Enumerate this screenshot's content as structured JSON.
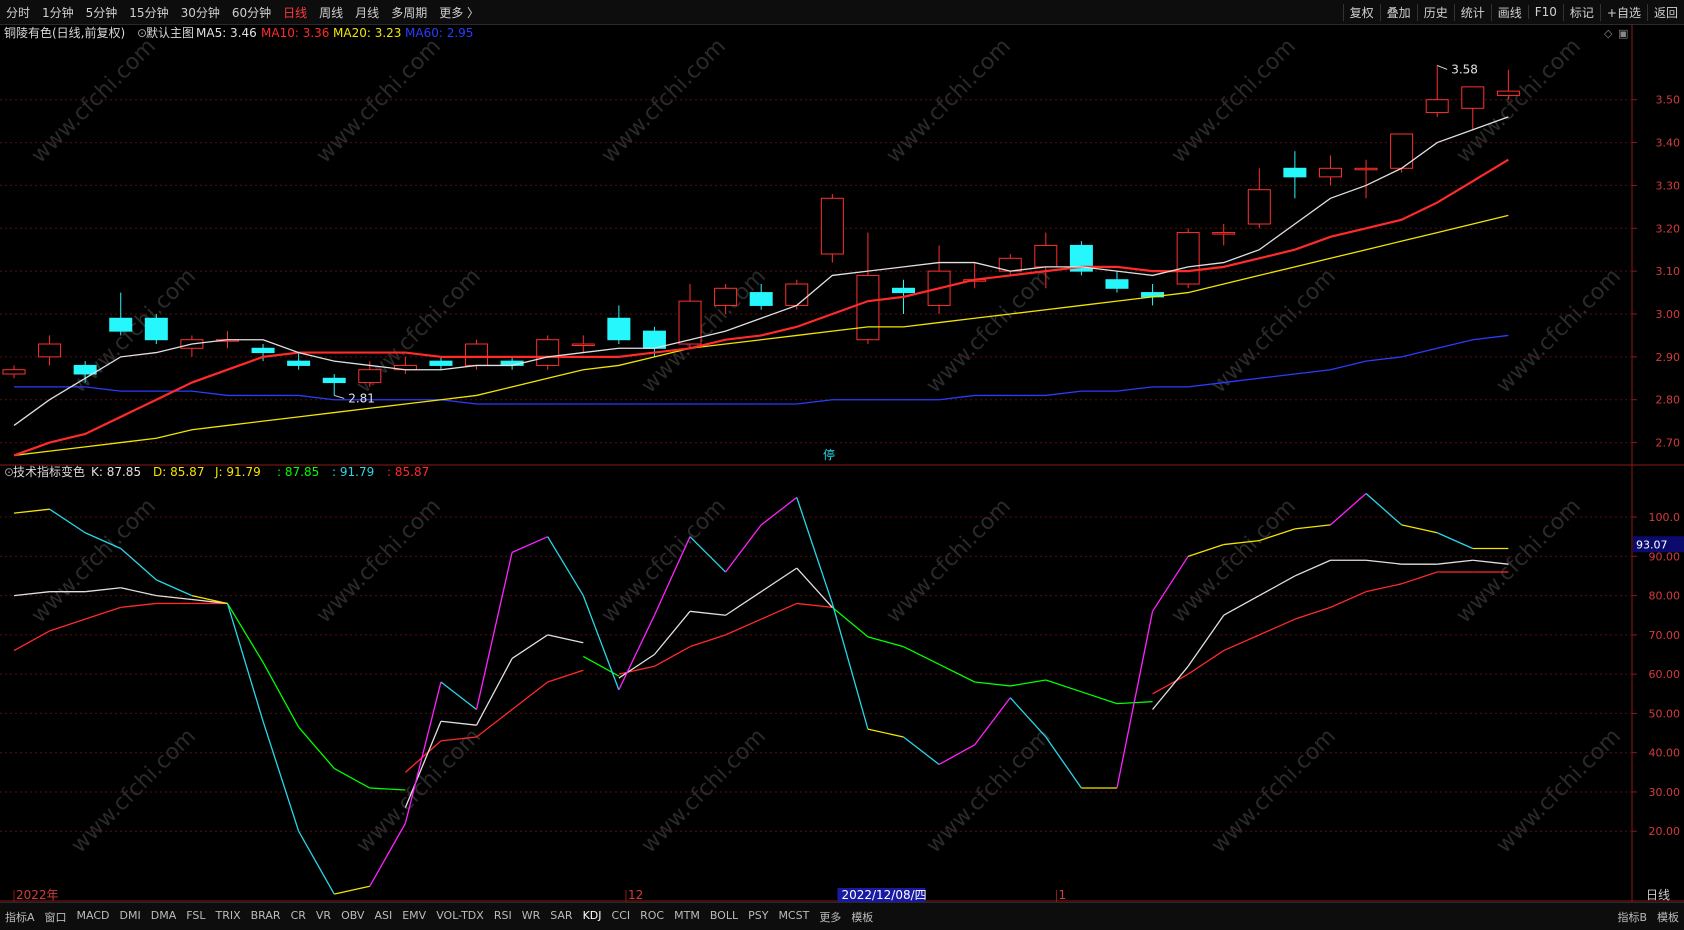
{
  "toolbar": {
    "periods": [
      "分时",
      "1分钟",
      "5分钟",
      "15分钟",
      "30分钟",
      "60分钟",
      "日线",
      "周线",
      "月线",
      "多周期",
      "更多 〉"
    ],
    "active_period": "日线",
    "actions": [
      "复权",
      "叠加",
      "历史",
      "统计",
      "画线",
      "F10",
      "标记",
      "+自选",
      "返回"
    ]
  },
  "main_panel": {
    "title": "铜陵有色(日线,前复权)",
    "indicator_name": "默认主图",
    "ma_labels": [
      {
        "text": "MA5: 3.46",
        "color": "#e0e0e0"
      },
      {
        "text": "MA10: 3.36",
        "color": "#ff2a2a"
      },
      {
        "text": "MA20: 3.23",
        "color": "#f2e400"
      },
      {
        "text": "MA60: 2.95",
        "color": "#2a3cff"
      }
    ],
    "high_label": "3.58",
    "low_label": "2.81",
    "marker_char": "停"
  },
  "sub_panel": {
    "indicator_name": "技术指标变色",
    "labels": [
      {
        "text": "K: 87.85",
        "color": "#e0e0e0"
      },
      {
        "text": "D: 85.87",
        "color": "#f2e400"
      },
      {
        "text": "J: 91.79",
        "color": "#f2e400"
      },
      {
        "text": ": 87.85",
        "color": "#00ff00"
      },
      {
        "text": ": 91.79",
        "color": "#27d8e8"
      },
      {
        "text": ": 85.87",
        "color": "#ff2a2a"
      }
    ],
    "current_value": "93.07"
  },
  "date_axis": {
    "labels": [
      {
        "text": "2022年",
        "index": 0
      },
      {
        "text": "12",
        "index": 17.2
      },
      {
        "text": "2022/12/08/四",
        "index": 23.2
      },
      {
        "text": "1",
        "index": 29.3
      }
    ],
    "right_label": "日线"
  },
  "bottom_tabs": [
    "指标A",
    "窗口",
    "MACD",
    "DMI",
    "DMA",
    "FSL",
    "TRIX",
    "BRAR",
    "CR",
    "VR",
    "OBV",
    "ASI",
    "EMV",
    "VOL-TDX",
    "RSI",
    "WR",
    "SAR",
    "KDJ",
    "CCI",
    "ROC",
    "MTM",
    "BOLL",
    "PSY",
    "MCST",
    "更多",
    "模板"
  ],
  "bottom_right": [
    "指标B",
    "模板"
  ],
  "watermark": "www.cfchi.com",
  "chart_data": {
    "type": "candlestick",
    "price_axis": {
      "ticks": [
        "2.70",
        "2.80",
        "2.90",
        "3.00",
        "3.10",
        "3.20",
        "3.30",
        "3.40",
        "3.50"
      ],
      "range": [
        2.65,
        3.63
      ]
    },
    "candles": [
      {
        "o": 2.86,
        "c": 2.87,
        "h": 2.88,
        "l": 2.85
      },
      {
        "o": 2.9,
        "c": 2.93,
        "h": 2.95,
        "l": 2.88
      },
      {
        "o": 2.88,
        "c": 2.86,
        "h": 2.89,
        "l": 2.84
      },
      {
        "o": 2.99,
        "c": 2.96,
        "h": 3.05,
        "l": 2.95
      },
      {
        "o": 2.99,
        "c": 2.94,
        "h": 3.0,
        "l": 2.93
      },
      {
        "o": 2.92,
        "c": 2.94,
        "h": 2.95,
        "l": 2.9
      },
      {
        "o": 2.94,
        "c": 2.94,
        "h": 2.96,
        "l": 2.92
      },
      {
        "o": 2.92,
        "c": 2.91,
        "h": 2.93,
        "l": 2.89
      },
      {
        "o": 2.89,
        "c": 2.88,
        "h": 2.91,
        "l": 2.87
      },
      {
        "o": 2.85,
        "c": 2.84,
        "h": 2.86,
        "l": 2.81
      },
      {
        "o": 2.84,
        "c": 2.87,
        "h": 2.89,
        "l": 2.83
      },
      {
        "o": 2.87,
        "c": 2.88,
        "h": 2.9,
        "l": 2.86
      },
      {
        "o": 2.89,
        "c": 2.88,
        "h": 2.9,
        "l": 2.87
      },
      {
        "o": 2.88,
        "c": 2.93,
        "h": 2.94,
        "l": 2.87
      },
      {
        "o": 2.89,
        "c": 2.88,
        "h": 2.9,
        "l": 2.87
      },
      {
        "o": 2.88,
        "c": 2.94,
        "h": 2.95,
        "l": 2.87
      },
      {
        "o": 2.93,
        "c": 2.93,
        "h": 2.95,
        "l": 2.91
      },
      {
        "o": 2.99,
        "c": 2.94,
        "h": 3.02,
        "l": 2.93
      },
      {
        "o": 2.96,
        "c": 2.92,
        "h": 2.97,
        "l": 2.9
      },
      {
        "o": 2.93,
        "c": 3.03,
        "h": 3.07,
        "l": 2.92
      },
      {
        "o": 3.02,
        "c": 3.06,
        "h": 3.07,
        "l": 3.0
      },
      {
        "o": 3.05,
        "c": 3.02,
        "h": 3.07,
        "l": 3.01
      },
      {
        "o": 3.02,
        "c": 3.07,
        "h": 3.08,
        "l": 3.01
      },
      {
        "o": 3.14,
        "c": 3.27,
        "h": 3.28,
        "l": 3.12
      },
      {
        "o": 2.94,
        "c": 3.09,
        "h": 3.19,
        "l": 2.93
      },
      {
        "o": 3.06,
        "c": 3.05,
        "h": 3.08,
        "l": 3.0
      },
      {
        "o": 3.02,
        "c": 3.1,
        "h": 3.16,
        "l": 3.0
      },
      {
        "o": 3.08,
        "c": 3.08,
        "h": 3.12,
        "l": 3.06
      },
      {
        "o": 3.1,
        "c": 3.13,
        "h": 3.14,
        "l": 3.09
      },
      {
        "o": 3.11,
        "c": 3.16,
        "h": 3.19,
        "l": 3.06
      },
      {
        "o": 3.16,
        "c": 3.1,
        "h": 3.17,
        "l": 3.09
      },
      {
        "o": 3.08,
        "c": 3.06,
        "h": 3.1,
        "l": 3.05
      },
      {
        "o": 3.05,
        "c": 3.04,
        "h": 3.07,
        "l": 3.02
      },
      {
        "o": 3.07,
        "c": 3.19,
        "h": 3.2,
        "l": 3.06
      },
      {
        "o": 3.19,
        "c": 3.19,
        "h": 3.21,
        "l": 3.16
      },
      {
        "o": 3.21,
        "c": 3.29,
        "h": 3.34,
        "l": 3.2
      },
      {
        "o": 3.34,
        "c": 3.32,
        "h": 3.38,
        "l": 3.27
      },
      {
        "o": 3.32,
        "c": 3.34,
        "h": 3.37,
        "l": 3.3
      },
      {
        "o": 3.34,
        "c": 3.34,
        "h": 3.36,
        "l": 3.27
      },
      {
        "o": 3.34,
        "c": 3.42,
        "h": 3.42,
        "l": 3.33
      },
      {
        "o": 3.47,
        "c": 3.5,
        "h": 3.58,
        "l": 3.46
      },
      {
        "o": 3.48,
        "c": 3.53,
        "h": 3.53,
        "l": 3.43
      },
      {
        "o": 3.51,
        "c": 3.52,
        "h": 3.57,
        "l": 3.5
      }
    ],
    "ma5": [
      2.74,
      2.8,
      2.85,
      2.9,
      2.91,
      2.93,
      2.94,
      2.94,
      2.91,
      2.89,
      2.88,
      2.87,
      2.87,
      2.88,
      2.88,
      2.9,
      2.91,
      2.92,
      2.92,
      2.94,
      2.96,
      2.99,
      3.02,
      3.09,
      3.1,
      3.11,
      3.12,
      3.12,
      3.1,
      3.11,
      3.11,
      3.1,
      3.09,
      3.11,
      3.12,
      3.15,
      3.21,
      3.27,
      3.3,
      3.34,
      3.4,
      3.43,
      3.46
    ],
    "ma10": [
      2.67,
      2.7,
      2.72,
      2.76,
      2.8,
      2.84,
      2.87,
      2.9,
      2.91,
      2.91,
      2.91,
      2.91,
      2.9,
      2.9,
      2.9,
      2.9,
      2.9,
      2.9,
      2.91,
      2.92,
      2.94,
      2.95,
      2.97,
      3.0,
      3.03,
      3.04,
      3.06,
      3.08,
      3.09,
      3.1,
      3.11,
      3.11,
      3.1,
      3.1,
      3.11,
      3.13,
      3.15,
      3.18,
      3.2,
      3.22,
      3.26,
      3.31,
      3.36
    ],
    "ma20": [
      2.67,
      2.68,
      2.69,
      2.7,
      2.71,
      2.73,
      2.74,
      2.75,
      2.76,
      2.77,
      2.78,
      2.79,
      2.8,
      2.81,
      2.83,
      2.85,
      2.87,
      2.88,
      2.9,
      2.92,
      2.93,
      2.94,
      2.95,
      2.96,
      2.97,
      2.97,
      2.98,
      2.99,
      3.0,
      3.01,
      3.02,
      3.03,
      3.04,
      3.05,
      3.07,
      3.09,
      3.11,
      3.13,
      3.15,
      3.17,
      3.19,
      3.21,
      3.23
    ],
    "ma60": [
      2.83,
      2.83,
      2.83,
      2.82,
      2.82,
      2.82,
      2.81,
      2.81,
      2.81,
      2.8,
      2.8,
      2.8,
      2.8,
      2.79,
      2.79,
      2.79,
      2.79,
      2.79,
      2.79,
      2.79,
      2.79,
      2.79,
      2.79,
      2.8,
      2.8,
      2.8,
      2.8,
      2.81,
      2.81,
      2.81,
      2.82,
      2.82,
      2.83,
      2.83,
      2.84,
      2.85,
      2.86,
      2.87,
      2.89,
      2.9,
      2.92,
      2.94,
      2.95
    ],
    "kdj_axis": {
      "ticks": [
        "20.00",
        "30.00",
        "40.00",
        "50.00",
        "60.00",
        "70.00",
        "80.00",
        "90.00",
        "100.0"
      ],
      "range": [
        3,
        113
      ]
    },
    "K": [
      80,
      81,
      81,
      82,
      80,
      79,
      78,
      60,
      40,
      28,
      25,
      26,
      48,
      47,
      64,
      70,
      68,
      59,
      65,
      76,
      75,
      81,
      87,
      77,
      66,
      64,
      59,
      54,
      54,
      58,
      54,
      50,
      51,
      62,
      75,
      80,
      85,
      89,
      89,
      88,
      88,
      89,
      88
    ],
    "D": [
      66,
      71,
      74,
      77,
      78,
      78,
      78,
      66,
      53,
      44,
      37,
      35,
      43,
      44,
      51,
      58,
      61,
      60,
      62,
      67,
      70,
      74,
      78,
      77,
      73,
      70,
      66,
      62,
      60,
      59,
      57,
      55,
      55,
      60,
      66,
      70,
      74,
      77,
      81,
      83,
      86,
      86,
      86
    ],
    "J": [
      101,
      102,
      96,
      92,
      84,
      80,
      78,
      48,
      20,
      4,
      6,
      22,
      58,
      51,
      91,
      95,
      80,
      56,
      75,
      95,
      86,
      98,
      105,
      78,
      46,
      44,
      37,
      42,
      54,
      44,
      31,
      31,
      76,
      90,
      93,
      94,
      97,
      98,
      106,
      98,
      96,
      92,
      92
    ],
    "line_color_K": "#e0e0e0",
    "line_color_D": "#ff2a2a",
    "line_color_J_up": "#ff22ff",
    "line_color_J_down": "#27d8e8",
    "line_color_J_flat": "#f2e400",
    "line_color_green": "#00ff00",
    "color_up": "#ff3030",
    "color_down": "#26f7fd",
    "color_ma5": "#e0e0e0",
    "color_ma10": "#ff2a2a",
    "color_ma20": "#f2e400",
    "color_ma60": "#2a3cff"
  }
}
